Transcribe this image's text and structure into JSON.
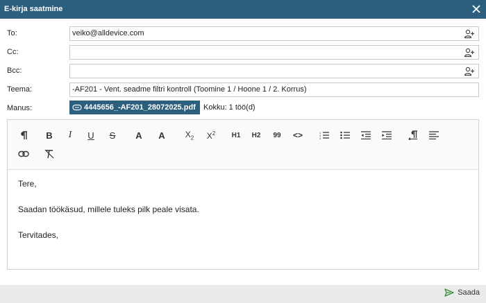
{
  "dialog": {
    "title": "E-kirja saatmine"
  },
  "fields": {
    "to_label": "To:",
    "to_value": "veiko@alldevice.com",
    "cc_label": "Cc:",
    "cc_value": "",
    "bcc_label": "Bcc:",
    "bcc_value": "",
    "subject_label": "Teema:",
    "subject_value": "-AF201 - Vent. seadme filtri kontroll (Toomine 1 / Hoone 1 / 2. Korrus)",
    "attachment_label": "Manus:",
    "attachment_name": "4445656_-AF201_28072025.pdf",
    "attachment_total": "Kokku: 1 töö(d)"
  },
  "toolbar": {
    "h1": "H1",
    "h2": "H2",
    "quote": "99",
    "code": "<>",
    "font_a1": "A",
    "font_a2": "A"
  },
  "body": {
    "line1": "Tere,",
    "line2": "Saadan töökäsud, millele tuleks pilk peale visata.",
    "line3": "Tervitades,"
  },
  "footer": {
    "send_label": "Saada"
  },
  "colors": {
    "header": "#2c5f7e",
    "send_icon": "#3a8a3a"
  }
}
